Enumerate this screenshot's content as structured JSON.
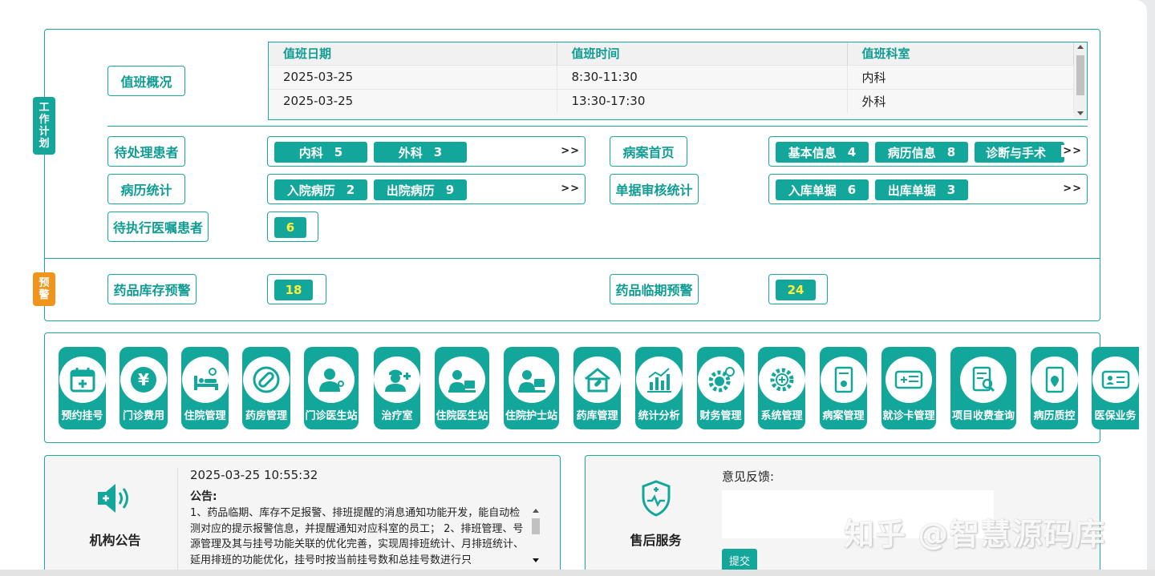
{
  "work_plan": {
    "tag": [
      "工",
      "作",
      "计",
      "划"
    ],
    "duty_overview_label": "值班概况",
    "duty_table": {
      "headers": [
        "值班日期",
        "值班时间",
        "值班科室"
      ],
      "rows": [
        [
          "2025-03-25",
          "8:30-11:30",
          "内科"
        ],
        [
          "2025-03-25",
          "13:30-17:30",
          "外科"
        ]
      ]
    },
    "pending_patients": {
      "label": "待处理患者",
      "items": [
        {
          "name": "内科",
          "count": "5"
        },
        {
          "name": "外科",
          "count": "3"
        }
      ],
      "more": ">>"
    },
    "medical_record_home": {
      "label": "病案首页",
      "items": [
        {
          "name": "基本信息",
          "count": "4"
        },
        {
          "name": "病历信息",
          "count": "8"
        },
        {
          "name": "诊断与手术",
          "count": ""
        }
      ],
      "more": ">>"
    },
    "record_stats": {
      "label": "病历统计",
      "items": [
        {
          "name": "入院病历",
          "count": "2"
        },
        {
          "name": "出院病历",
          "count": "9"
        }
      ],
      "more": ">>"
    },
    "voucher_audit": {
      "label": "单据审核统计",
      "items": [
        {
          "name": "入库单据",
          "count": "6"
        },
        {
          "name": "出库单据",
          "count": "3"
        }
      ],
      "more": ">>"
    },
    "pending_orders": {
      "label": "待执行医嘱患者",
      "count": "6"
    }
  },
  "warning": {
    "tag": [
      "预",
      "警"
    ],
    "stock_warning": {
      "label": "药品库存预警",
      "count": "18"
    },
    "expiry_warning": {
      "label": "药品临期预警",
      "count": "24"
    }
  },
  "modules": [
    {
      "name": "预约挂号",
      "icon": "calendar-plus-icon"
    },
    {
      "name": "门诊费用",
      "icon": "yen-icon"
    },
    {
      "name": "住院管理",
      "icon": "hospital-bed-icon"
    },
    {
      "name": "药房管理",
      "icon": "pill-icon"
    },
    {
      "name": "门诊医生站",
      "icon": "doctor-icon"
    },
    {
      "name": "治疗室",
      "icon": "nurse-icon"
    },
    {
      "name": "住院医生站",
      "icon": "inpatient-doctor-icon"
    },
    {
      "name": "住院护士站",
      "icon": "nurse-station-icon"
    },
    {
      "name": "药库管理",
      "icon": "warehouse-icon"
    },
    {
      "name": "统计分析",
      "icon": "bar-chart-icon"
    },
    {
      "name": "财务管理",
      "icon": "finance-gear-icon"
    },
    {
      "name": "系统管理",
      "icon": "system-gear-icon"
    },
    {
      "name": "病案管理",
      "icon": "record-file-icon"
    },
    {
      "name": "就诊卡管理",
      "icon": "card-icon"
    },
    {
      "name": "项目收费查询",
      "icon": "search-document-icon"
    },
    {
      "name": "病历质控",
      "icon": "quality-control-icon"
    },
    {
      "name": "医保业务",
      "icon": "insurance-card-icon"
    }
  ],
  "notice": {
    "title": "机构公告",
    "icon": "speaker-icon",
    "datetime": "2025-03-25 10:55:32",
    "heading": "公告:",
    "body": "1、药品临期、库存不足报警、排班提醒的消息通知功能开发，能自动检测对应的提示报警信息，并提醒通知对应科室的员工；  2、排班管理、号源管理及其与挂号功能关联的优化完善，实现周排班统计、月排班统计、延用排班的功能优化，挂号时按当前挂号数和总挂号数进行只"
  },
  "after_sales": {
    "title": "售后服务",
    "icon": "shield-heart-icon",
    "feedback_label": "意见反馈:",
    "feedback_value": "",
    "submit_label": "提交"
  },
  "watermark": "知乎 @智慧源码库",
  "colors": {
    "teal": "#13a79b",
    "orange": "#f0941e",
    "yellow": "#ffef3a"
  }
}
